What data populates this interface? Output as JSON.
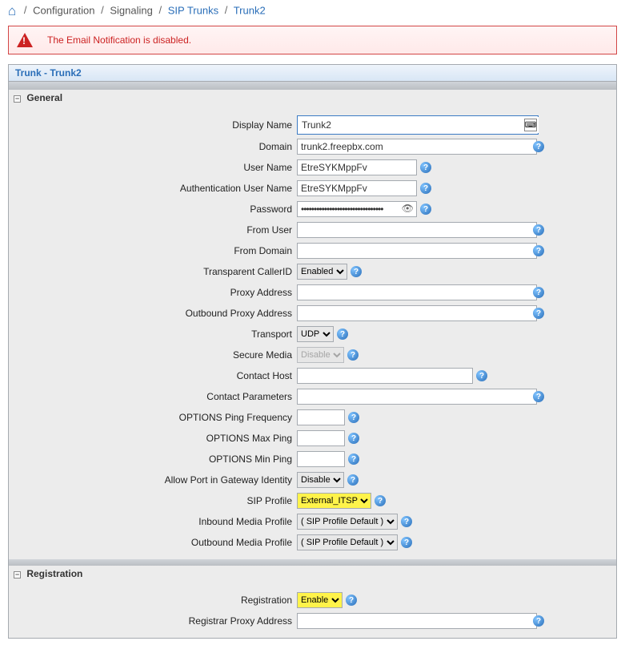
{
  "breadcrumb": {
    "home_icon": "⌂",
    "configuration": "Configuration",
    "signaling": "Signaling",
    "sip_trunks": "SIP Trunks",
    "current": "Trunk2"
  },
  "alert": {
    "message": "The Email Notification is disabled."
  },
  "panel": {
    "title": "Trunk - Trunk2"
  },
  "sections": {
    "general": "General",
    "registration": "Registration"
  },
  "labels": {
    "display_name": "Display Name",
    "domain": "Domain",
    "user_name": "User Name",
    "auth_user_name": "Authentication User Name",
    "password": "Password",
    "from_user": "From User",
    "from_domain": "From Domain",
    "transparent_cid": "Transparent CallerID",
    "proxy_address": "Proxy Address",
    "outbound_proxy_address": "Outbound Proxy Address",
    "transport": "Transport",
    "secure_media": "Secure Media",
    "contact_host": "Contact Host",
    "contact_parameters": "Contact Parameters",
    "options_ping_freq": "OPTIONS Ping Frequency",
    "options_max_ping": "OPTIONS Max Ping",
    "options_min_ping": "OPTIONS Min Ping",
    "allow_port_gw": "Allow Port in Gateway Identity",
    "sip_profile": "SIP Profile",
    "inbound_media_profile": "Inbound Media Profile",
    "outbound_media_profile": "Outbound Media Profile",
    "registration": "Registration",
    "registrar_proxy_address": "Registrar Proxy Address"
  },
  "values": {
    "display_name": "Trunk2",
    "domain": "trunk2.freepbx.com",
    "user_name": "EtreSYKMppFv",
    "auth_user_name": "EtreSYKMppFv",
    "password": "••••••••••••••••••••••••••••••••",
    "from_user": "",
    "from_domain": "",
    "transparent_cid": "Enabled",
    "proxy_address": "",
    "outbound_proxy_address": "",
    "transport": "UDP",
    "secure_media": "Disable",
    "contact_host": "",
    "contact_parameters": "",
    "options_ping_freq": "",
    "options_max_ping": "",
    "options_min_ping": "",
    "allow_port_gw": "Disable",
    "sip_profile": "External_ITSP",
    "inbound_media_profile": "( SIP Profile Default )",
    "outbound_media_profile": "( SIP Profile Default )",
    "registration": "Enable",
    "registrar_proxy_address": ""
  },
  "help_glyph": "?"
}
